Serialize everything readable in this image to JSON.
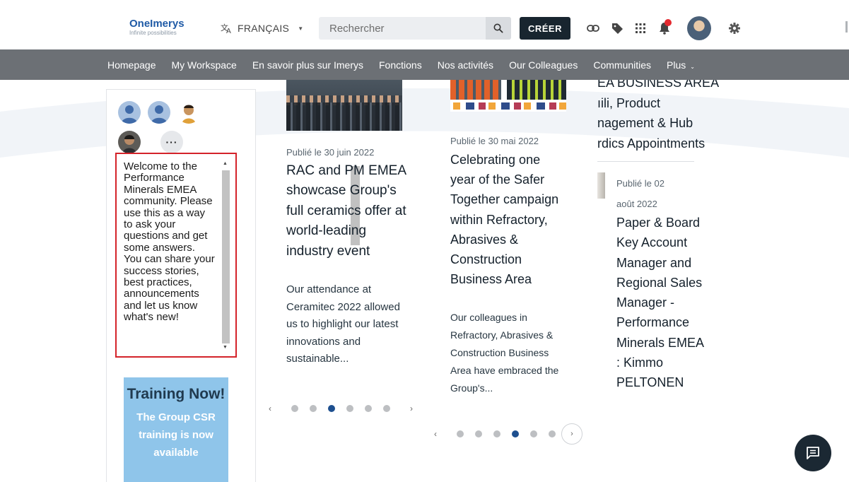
{
  "brand": {
    "name": "OneImerys",
    "tagline": "Infinite possibilities"
  },
  "language": {
    "label": "FRANÇAIS",
    "icon": "translate-icon"
  },
  "search": {
    "placeholder": "Rechercher"
  },
  "toolbar": {
    "create_label": "CRÉER",
    "icons": [
      "link-icon",
      "tag-icon",
      "apps-grid-icon",
      "bell-icon",
      "user-avatar",
      "gear-icon"
    ],
    "accent_color": "#18252f",
    "notification_color": "#e4292f"
  },
  "nav": {
    "items": [
      "Homepage",
      "My Workspace",
      "En savoir plus sur Imerys",
      "Fonctions",
      "Nos activités",
      "Our Colleagues",
      "Communities"
    ],
    "more_label": "Plus",
    "bar_color": "#6c7075"
  },
  "community_panel": {
    "more_members_label": "···",
    "welcome_text": "Welcome to the Performance Minerals EMEA community. Please use this as a way to ask your questions and get some answers. You can share your success stories, best practices, announcements and let us know what's new!",
    "training": {
      "title": "Training Now!",
      "body": "The Group CSR training is now available"
    }
  },
  "news": [
    {
      "date": "Publié le 30 juin 2022",
      "title": "RAC and PM EMEA showcase Group's full ceramics offer at world-leading industry event",
      "excerpt": "Our attendance at Ceramitec 2022 allowed us to highlight our latest innovations and sustainable...",
      "carousel": {
        "count": 6,
        "active": 3
      }
    },
    {
      "date": "Publié le 30 mai 2022",
      "title": "Celebrating one year of the Safer Together campaign within Refractory, Abrasives & Construction Business Area",
      "excerpt": "Our colleagues in Refractory, Abrasives & Construction Business Area have embraced the Group's...",
      "carousel": {
        "count": 6,
        "active": 4
      }
    }
  ],
  "appointments": {
    "heading_lines": [
      "EA BUSINESS AREA",
      "ıili, Product",
      "nagement & Hub",
      "rdics Appointments"
    ],
    "date": "Publié le 02 août 2022",
    "title": "Paper & Board Key Account Manager and Regional Sales Manager - Performance Minerals EMEA : Kimmo PELTONEN"
  },
  "chat": {
    "icon": "chat-icon"
  }
}
